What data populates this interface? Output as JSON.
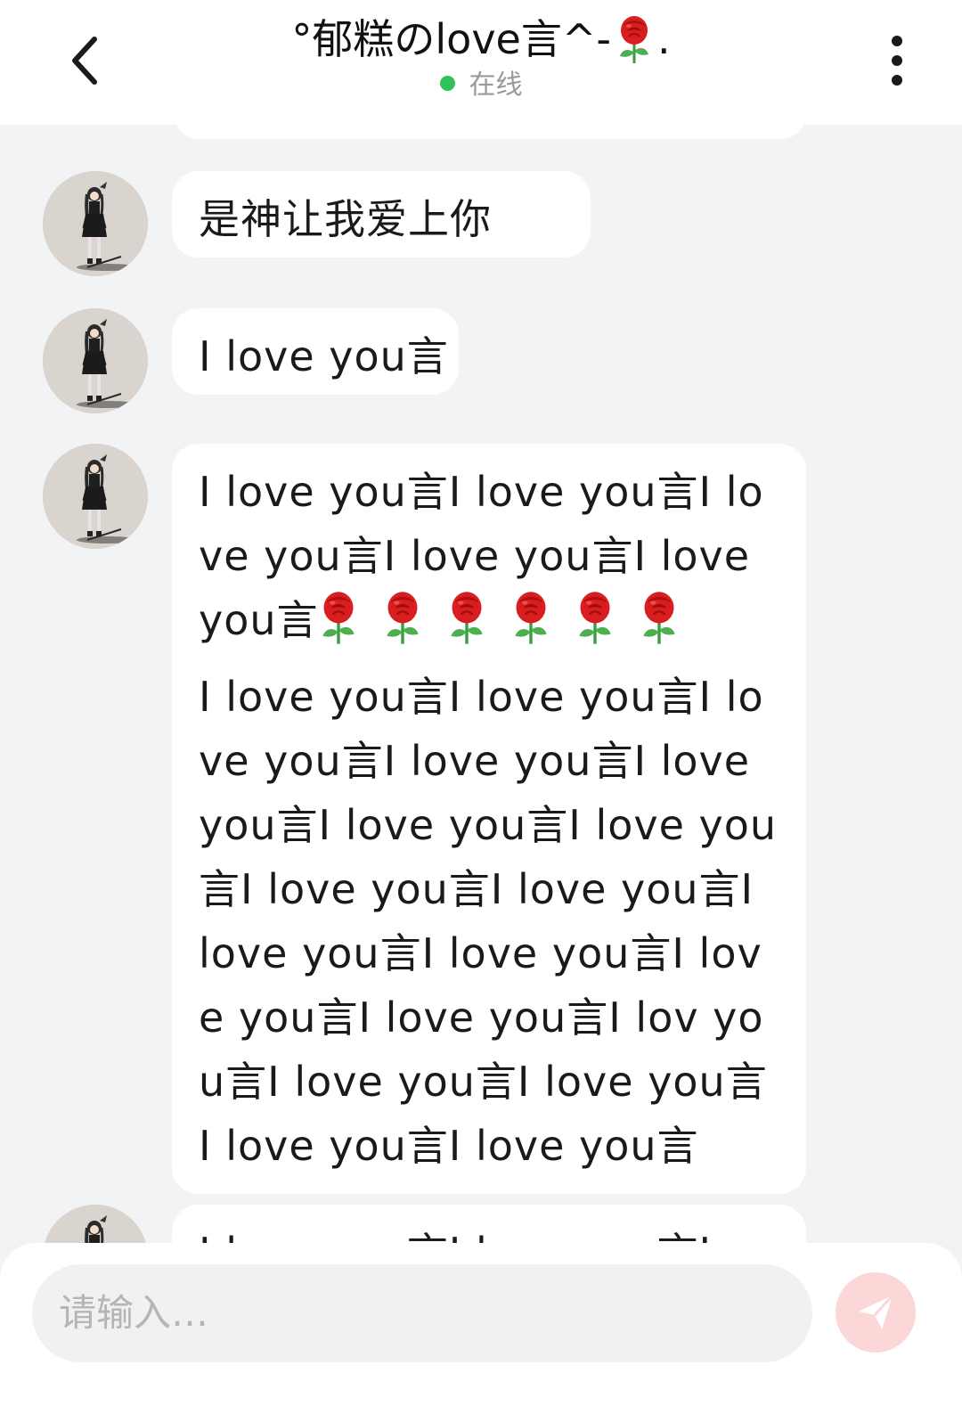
{
  "header": {
    "title_prefix": "°郁糕のlove言^-",
    "title_suffix": ".",
    "title_emoji": "rose-emoji",
    "status_text": "在线",
    "status_color": "#2fc35a",
    "back_icon": "chevron-left-icon",
    "more_icon": "more-vertical-icon"
  },
  "messages": [
    {
      "sender": "contact",
      "text": "是神让我爱上你"
    },
    {
      "sender": "contact",
      "text": "I love you言"
    },
    {
      "sender": "contact",
      "text_before_roses": "I love you言I love you言I love you言I love you言I love you言",
      "rose_count": 6,
      "text_after_roses": "I love you言I love you言I love you言I love you言I love you言I love you言I love you言I love you言I love you言I love you言I love you言I love you言I love you言I lov you言I love you言I love you言I love you言I love you言"
    },
    {
      "sender": "contact",
      "text": "I love you言I love you言I"
    }
  ],
  "composer": {
    "placeholder": "请输入…",
    "send_icon": "send-paper-plane-icon",
    "send_color": "#fbd7d7"
  }
}
